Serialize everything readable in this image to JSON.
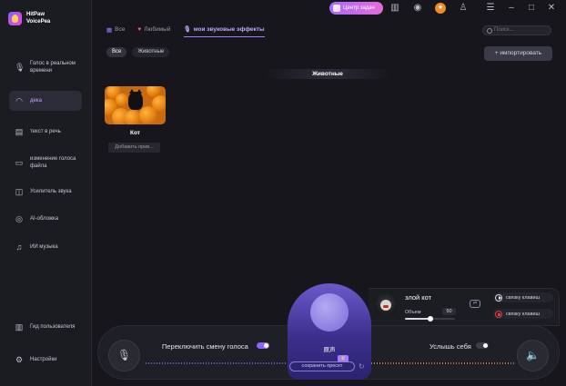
{
  "app": {
    "name": "HitPaw VoicePea"
  },
  "titlebar": {
    "task_center": "Центр задач",
    "icons": [
      "book-icon",
      "discord-icon",
      "gift-icon",
      "user-icon",
      "settings-icon",
      "minimize-icon",
      "maximize-icon",
      "close-icon"
    ]
  },
  "sidebar": {
    "items": [
      {
        "label": "Голос в реальном времени",
        "icon": "mic-icon"
      },
      {
        "label": "дека",
        "icon": "headphones-icon",
        "active": true
      },
      {
        "label": "текст в речь",
        "icon": "text-speech-icon"
      },
      {
        "label": "изменение голоса файла",
        "icon": "file-voice-icon"
      },
      {
        "label": "Усилитель звука",
        "icon": "amplifier-icon"
      },
      {
        "label": "AI-обложка",
        "icon": "ai-cover-icon"
      },
      {
        "label": "ИИ музыка",
        "icon": "ai-music-icon"
      }
    ],
    "bottom_items": [
      {
        "label": "Гид пользователя",
        "icon": "guide-icon"
      },
      {
        "label": "Настройки",
        "icon": "gear-icon"
      }
    ]
  },
  "tabs": [
    {
      "label": "Все",
      "icon": "grid-icon"
    },
    {
      "label": "Любимый",
      "icon": "heart-icon"
    },
    {
      "label": "мои звуковые эффекты",
      "icon": "mic-icon",
      "active": true
    }
  ],
  "search": {
    "placeholder": "Поиск..."
  },
  "filters": [
    {
      "label": "Все",
      "active": true
    },
    {
      "label": "Животные"
    }
  ],
  "import_button": "+ импортировать",
  "section_title": "Животные",
  "cards": [
    {
      "name": "Кот",
      "bind_label": "Добавить прив..."
    }
  ],
  "bottom": {
    "switch_label": "Переключить смену голоса",
    "switch_on": true,
    "hear_label": "Услышь себя",
    "hear_on": false
  },
  "voice_panel": {
    "label": "原声",
    "save_preset": "сохранить пресет"
  },
  "effect": {
    "name": "злой кот",
    "volume_label": "Объем",
    "volume_value": "50",
    "volume_fraction": 0.5,
    "hotkey_play": "связку клавиш",
    "hotkey_stop": "связку клавиш"
  },
  "colors": {
    "accent": "#a77bff",
    "background": "#16161c",
    "sidebar": "#1b1b22",
    "orange": "#f08a24"
  }
}
